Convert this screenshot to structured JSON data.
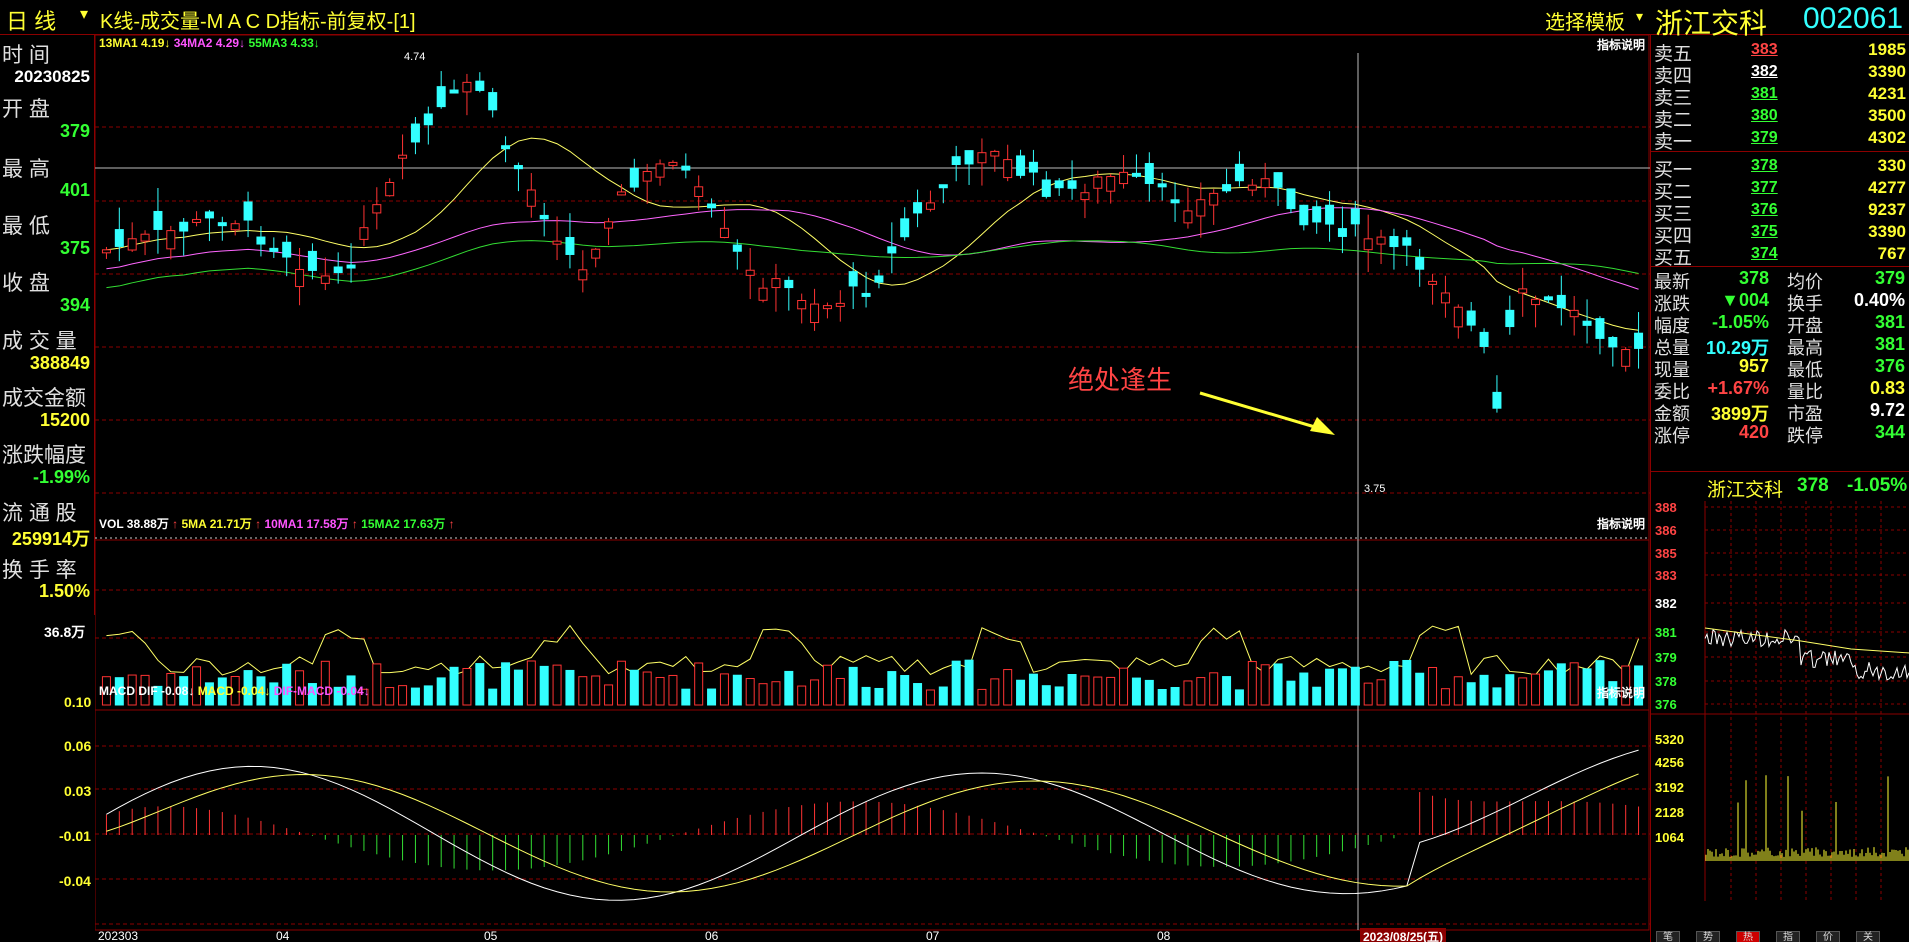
{
  "header": {
    "period": "日 线",
    "dropdown_arrow": "▾",
    "title": "K线-成交量-M A C D指标-前复权-[1]",
    "template": "选择模板",
    "stock_name": "浙江交科",
    "stock_code": "002061"
  },
  "left_panel": {
    "time_label": "时  间",
    "time_value": "20230825",
    "open_label": "开  盘",
    "open_value": "379",
    "high_label": "最  高",
    "high_value": "401",
    "low_label": "最  低",
    "low_value": "375",
    "close_label": "收  盘",
    "close_value": "394",
    "volume_label": "成 交 量",
    "volume_value": "388849",
    "amount_label": "成交金额",
    "amount_value": "15200",
    "change_label": "涨跌幅度",
    "change_value": "-1.99%",
    "float_label": "流 通 股",
    "float_value": "259914万",
    "turnover_label": "换 手 率",
    "turnover_value": "1.50%"
  },
  "main_chart": {
    "ma_legend": [
      {
        "text": "13MA1 4.19↓",
        "color": "#ffff33"
      },
      {
        "text": "34MA2 4.29↓",
        "color": "#ff55ff"
      },
      {
        "text": "55MA3 4.33↓",
        "color": "#33ff33"
      }
    ],
    "indicator_help": "指标说明",
    "high_marker": "4.74",
    "low_marker": "3.75",
    "annotation": "绝处逢生"
  },
  "volume_chart": {
    "legend": [
      {
        "text": "VOL 38.88万",
        "color": "#ffffff"
      },
      {
        "text": "↑",
        "color": "#ff4444"
      },
      {
        "text": "5MA 21.71万",
        "color": "#ffff33"
      },
      {
        "text": "↑",
        "color": "#ff4444"
      },
      {
        "text": "10MA1 17.58万",
        "color": "#ff55ff"
      },
      {
        "text": "↑",
        "color": "#ff4444"
      },
      {
        "text": "15MA2 17.63万",
        "color": "#33ff33"
      },
      {
        "text": "↑",
        "color": "#ff4444"
      }
    ],
    "axis_label": "36.8万",
    "indicator_help": "指标说明"
  },
  "macd_chart": {
    "legend": [
      {
        "text": "MACD DIF -0.08↓",
        "color": "#ffffff"
      },
      {
        "text": "MACD -0.04↓",
        "color": "#ffff33"
      },
      {
        "text": "DIF-MACD -0.04↓",
        "color": "#ff55ff"
      }
    ],
    "yticks": [
      "0.10",
      "0.06",
      "0.03",
      "-0.01",
      "-0.04"
    ],
    "indicator_help": "指标说明"
  },
  "x_axis": {
    "labels": [
      "202303",
      "04",
      "05",
      "06",
      "07",
      "08"
    ],
    "cursor_date": "2023/08/25(五)"
  },
  "order_book": {
    "sells": [
      {
        "label": "卖五",
        "price": "383",
        "vol": "1985",
        "color": "#ff4444"
      },
      {
        "label": "卖四",
        "price": "382",
        "vol": "3390",
        "color": "#ffffff"
      },
      {
        "label": "卖三",
        "price": "381",
        "vol": "4231",
        "color": "#33ff33"
      },
      {
        "label": "卖二",
        "price": "380",
        "vol": "3500",
        "color": "#33ff33"
      },
      {
        "label": "卖一",
        "price": "379",
        "vol": "4302",
        "color": "#33ff33"
      }
    ],
    "buys": [
      {
        "label": "买一",
        "price": "378",
        "vol": "330",
        "color": "#33ff33"
      },
      {
        "label": "买二",
        "price": "377",
        "vol": "4277",
        "color": "#33ff33"
      },
      {
        "label": "买三",
        "price": "376",
        "vol": "9237",
        "color": "#33ff33"
      },
      {
        "label": "买四",
        "price": "375",
        "vol": "3390",
        "color": "#33ff33"
      },
      {
        "label": "买五",
        "price": "374",
        "vol": "767",
        "color": "#33ff33"
      }
    ]
  },
  "stats": [
    {
      "l1": "最新",
      "v1": "378",
      "c1": "#33ff33",
      "l2": "均价",
      "v2": "379",
      "c2": "#33ff33"
    },
    {
      "l1": "涨跌",
      "v1": "▼004",
      "c1": "#33ff33",
      "l2": "换手",
      "v2": "0.40%",
      "c2": "#ffffff"
    },
    {
      "l1": "幅度",
      "v1": "-1.05%",
      "c1": "#33ff33",
      "l2": "开盘",
      "v2": "381",
      "c2": "#33ff33"
    },
    {
      "l1": "总量",
      "v1": "10.29万",
      "c1": "#33ffff",
      "l2": "最高",
      "v2": "381",
      "c2": "#33ff33"
    },
    {
      "l1": "现量",
      "v1": "957",
      "c1": "#ffff33",
      "l2": "最低",
      "v2": "376",
      "c2": "#33ff33"
    },
    {
      "l1": "委比",
      "v1": "+1.67%",
      "c1": "#ff4444",
      "l2": "量比",
      "v2": "0.83",
      "c2": "#ffff33"
    },
    {
      "l1": "金额",
      "v1": "3899万",
      "c1": "#ffff33",
      "l2": "市盈",
      "v2": "9.72",
      "c2": "#ffffff"
    },
    {
      "l1": "涨停",
      "v1": "420",
      "c1": "#ff4444",
      "l2": "跌停",
      "v2": "344",
      "c2": "#33ff33"
    }
  ],
  "mini_chart": {
    "name": "浙江交科",
    "price": "378",
    "change": "-1.05%",
    "price_ticks": [
      {
        "t": "388",
        "c": "#ff4444"
      },
      {
        "t": "386",
        "c": "#ff4444"
      },
      {
        "t": "385",
        "c": "#ff4444"
      },
      {
        "t": "383",
        "c": "#ff4444"
      },
      {
        "t": "382",
        "c": "#ffffff"
      },
      {
        "t": "381",
        "c": "#33ff33"
      },
      {
        "t": "379",
        "c": "#33ff33"
      },
      {
        "t": "378",
        "c": "#33ff33"
      },
      {
        "t": "376",
        "c": "#33ff33"
      }
    ],
    "vol_ticks": [
      "5320",
      "4256",
      "3192",
      "2128",
      "1064"
    ]
  },
  "bottom_tabs": [
    "笔",
    "势",
    "热",
    "指",
    "价",
    "关"
  ],
  "colors": {
    "up": "#ff3333",
    "down": "#33ffff",
    "ma13": "#ffff66",
    "ma34": "#ff66ff",
    "ma55": "#33dd33",
    "grid": "#8b0000",
    "bg": "#000000"
  }
}
